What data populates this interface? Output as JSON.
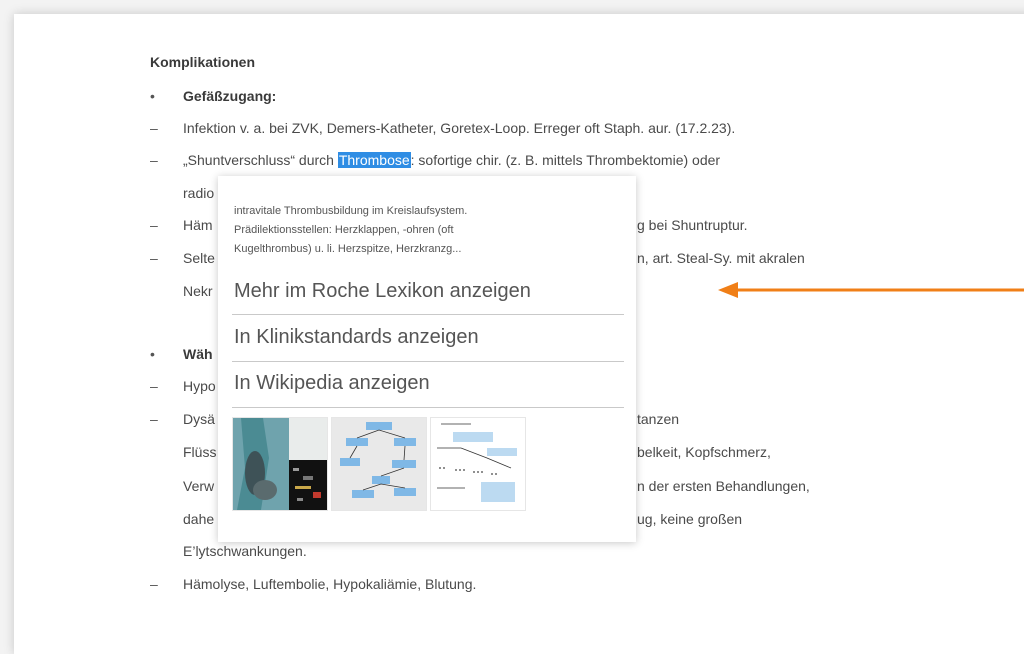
{
  "document": {
    "heading": "Komplikationen",
    "bullet_marker": "•",
    "dash_marker": "–",
    "section1_title": "Gefäßzugang:",
    "line1": "Infektion v. a. bei ZVK, Demers-Katheter, Goretex-Loop. Erreger oft Staph. aur. (17.2.23).",
    "line2_pre": "„Shuntverschluss“ durch ",
    "line2_highlight": "Thrombose",
    "line2_post": ": sofortige chir. (z. B. mittels Thrombektomie) oder",
    "line3": "radio",
    "line4_start": "Häm",
    "line4_end": "g bei Shuntruptur.",
    "line5_start": "Selte",
    "line5_end": "n, art. Steal-Sy. mit akralen",
    "line6": "Nekr",
    "section2_title": "Wäh",
    "line7": "Hypo",
    "line8_start": "Dysä",
    "line8_end": "tanzen",
    "line9_start": "Flüss",
    "line9_end": "belkeit, Kopfschmerz,",
    "line10_start": "Verw",
    "line10_end": "n der ersten Behandlungen,",
    "line11_start": "dahe",
    "line11_end": "ug, keine großen",
    "line12": "E’lytschwankungen.",
    "line13": "Hämolyse, Luftembolie, Hypokaliämie, Blutung."
  },
  "popup": {
    "desc_line1": "intravitale Thrombusbildung im Kreislaufsystem.",
    "desc_line2": "Prädilektionsstellen: Herzklappen, -ohren (oft",
    "desc_line3": "Kugelthrombus) u. li. Herzspitze, Herzkranzg...",
    "link_roche": "Mehr im Roche Lexikon anzeigen",
    "link_klinik": "In Klinikstandards anzeigen",
    "link_wiki": "In Wikipedia anzeigen"
  },
  "colors": {
    "highlight": "#2f8de4",
    "arrow": "#f07f17"
  }
}
